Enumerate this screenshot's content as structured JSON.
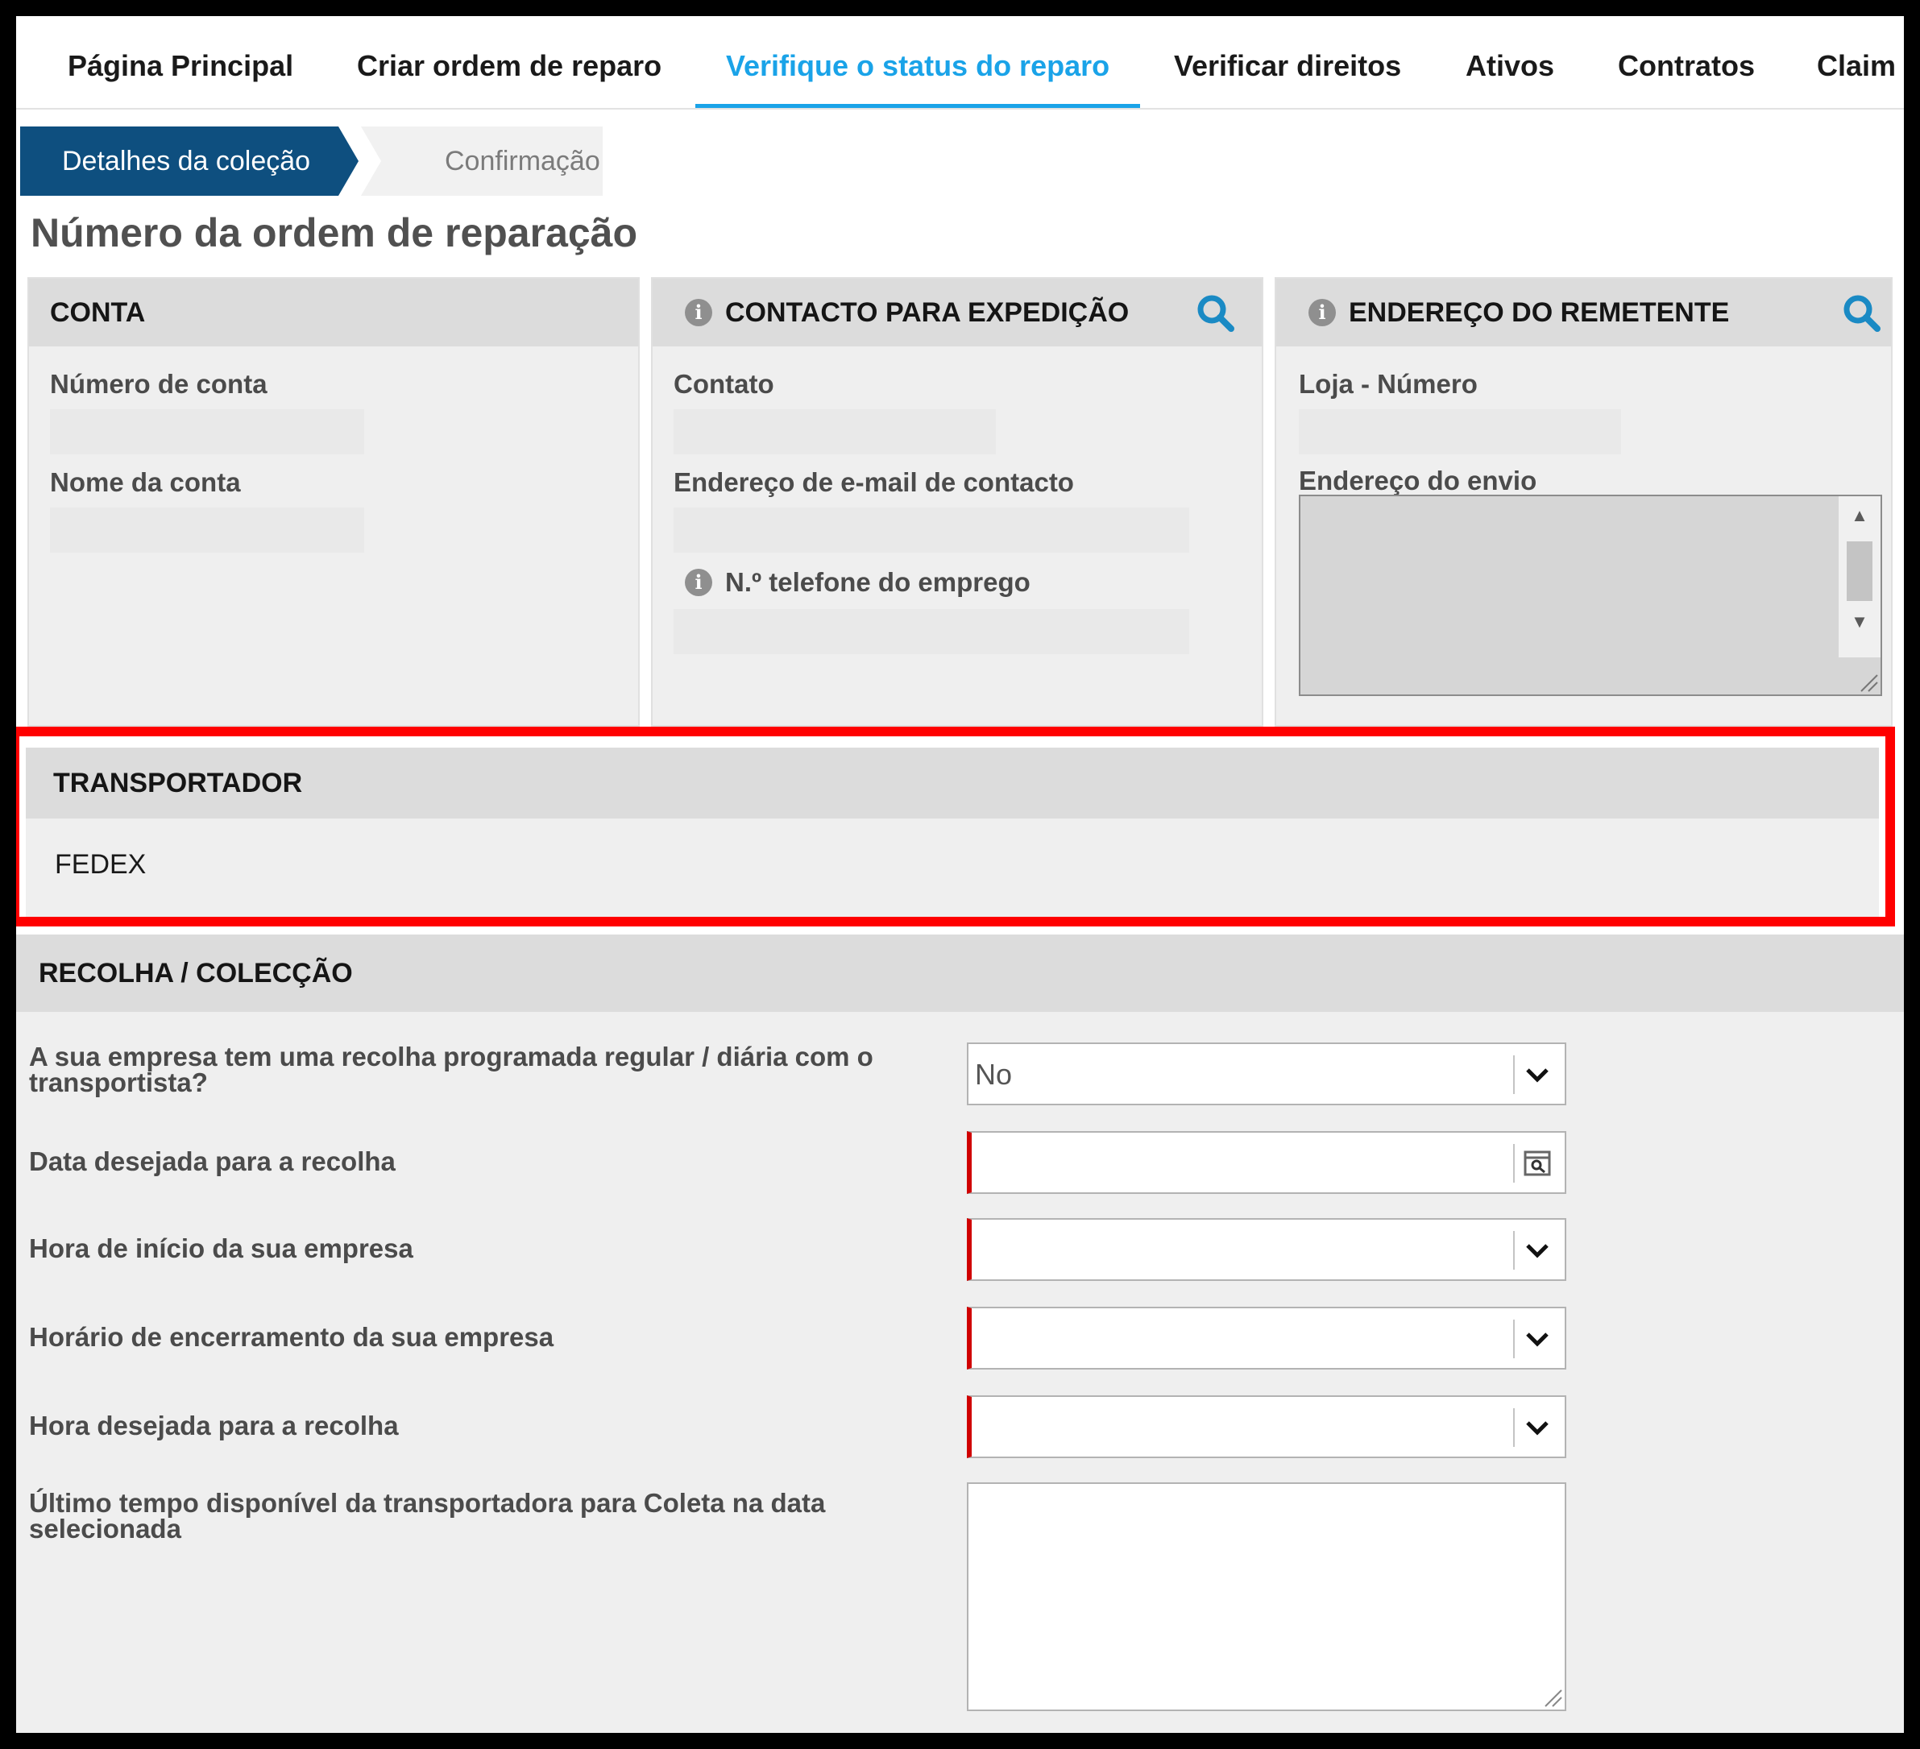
{
  "nav": {
    "items": [
      {
        "label": "Página Principal"
      },
      {
        "label": "Criar ordem de reparo"
      },
      {
        "label": "Verifique o status do reparo",
        "active": true
      },
      {
        "label": "Verificar direitos"
      },
      {
        "label": "Ativos"
      },
      {
        "label": "Contratos"
      },
      {
        "label": "Claim"
      }
    ]
  },
  "steps": [
    {
      "label": "Detalhes da coleção",
      "active": true
    },
    {
      "label": "Confirmação"
    }
  ],
  "page_title": "Número da ordem de reparação",
  "cards": {
    "account": {
      "title": "CONTA",
      "account_number_label": "Número de conta",
      "account_number_value": "",
      "account_name_label": "Nome da conta",
      "account_name_value": ""
    },
    "shipping_contact": {
      "title": "CONTACTO PARA EXPEDIÇÃO",
      "contact_label": "Contato",
      "contact_value": "",
      "email_label": "Endereço de e-mail de contacto",
      "email_value": "",
      "phone_label": "N.º telefone do emprego",
      "phone_value": ""
    },
    "sender_address": {
      "title": "ENDEREÇO DO REMETENTE",
      "store_label": "Loja - Número",
      "store_value": "",
      "ship_address_label": "Endereço do envio",
      "ship_address_value": ""
    }
  },
  "carrier": {
    "title": "TRANSPORTADOR",
    "value": "FEDEX"
  },
  "pickup": {
    "title": "RECOLHA / COLECÇÃO",
    "fields": [
      {
        "label": "A sua empresa tem uma recolha programada regular / diária com o transportista?",
        "value": "No"
      },
      {
        "label": "Data desejada para a recolha",
        "value": ""
      },
      {
        "label": "Hora de início da sua empresa",
        "value": ""
      },
      {
        "label": "Horário de encerramento da sua empresa",
        "value": ""
      },
      {
        "label": "Hora desejada para a recolha",
        "value": ""
      },
      {
        "label": "Último tempo disponível da transportadora para Coleta na data selecionada",
        "value": ""
      }
    ]
  },
  "colors": {
    "active_tab": "#1aa3e8",
    "step_active": "#0e4f7f",
    "highlight": "#ff0000",
    "required": "#d00000",
    "icon_blue": "#1a8ac4"
  }
}
